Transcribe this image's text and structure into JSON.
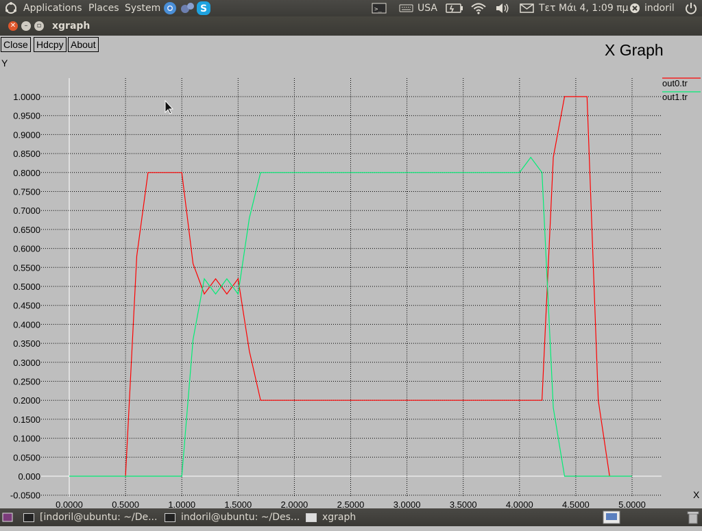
{
  "top_panel": {
    "menus": [
      "Applications",
      "Places",
      "System"
    ],
    "keyboard_layout": "USA",
    "clock": "Τετ Μάι  4,  1:09 πμ",
    "user": "indoril"
  },
  "window": {
    "title": "xgraph"
  },
  "toolbar": {
    "close_label": "Close",
    "hdcpy_label": "Hdcpy",
    "about_label": "About"
  },
  "graph": {
    "title": "X Graph"
  },
  "chart_data": {
    "type": "line",
    "title": "X Graph",
    "xlabel": "X",
    "ylabel": "Y",
    "xlim": [
      -0.1,
      5.25
    ],
    "ylim": [
      -0.05,
      1.05
    ],
    "x_ticks": [
      "0.0000",
      "0.5000",
      "1.0000",
      "1.5000",
      "2.0000",
      "2.5000",
      "3.0000",
      "3.5000",
      "4.0000",
      "4.5000",
      "5.0000"
    ],
    "y_ticks": [
      "-0.0500",
      "0.000",
      "0.0500",
      "0.1000",
      "0.1500",
      "0.2000",
      "0.2500",
      "0.3000",
      "0.3500",
      "0.4000",
      "0.4500",
      "0.5000",
      "0.5500",
      "0.6000",
      "0.6500",
      "0.7000",
      "0.7500",
      "0.8000",
      "0.8500",
      "0.9000",
      "0.9500",
      "1.0000"
    ],
    "grid": true,
    "legend": "top-right",
    "series": [
      {
        "name": "out0.tr",
        "color": "#ff0000",
        "x": [
          0.5,
          0.6,
          0.7,
          1.0,
          1.1,
          1.2,
          1.3,
          1.4,
          1.5,
          1.6,
          1.7,
          2.0,
          2.5,
          3.0,
          3.5,
          4.0,
          4.2,
          4.3,
          4.4,
          4.6,
          4.7,
          4.8
        ],
        "y": [
          0.0,
          0.58,
          0.8,
          0.8,
          0.56,
          0.48,
          0.52,
          0.48,
          0.52,
          0.33,
          0.2,
          0.2,
          0.2,
          0.2,
          0.2,
          0.2,
          0.2,
          0.84,
          1.0,
          1.0,
          0.2,
          0.0
        ]
      },
      {
        "name": "out1.tr",
        "color": "#00ee76",
        "x": [
          0.0,
          0.5,
          1.0,
          1.1,
          1.2,
          1.3,
          1.4,
          1.5,
          1.6,
          1.7,
          2.0,
          2.5,
          3.0,
          3.5,
          4.0,
          4.1,
          4.2,
          4.3,
          4.4,
          4.6,
          4.8,
          5.0
        ],
        "y": [
          0.0,
          0.0,
          0.0,
          0.36,
          0.52,
          0.48,
          0.52,
          0.48,
          0.68,
          0.8,
          0.8,
          0.8,
          0.8,
          0.8,
          0.8,
          0.84,
          0.8,
          0.18,
          0.0,
          0.0,
          0.0,
          0.0
        ]
      }
    ]
  },
  "taskbar": {
    "tasks": [
      "[indoril@ubuntu: ~/De...",
      "indoril@ubuntu: ~/Des...",
      "xgraph"
    ]
  }
}
